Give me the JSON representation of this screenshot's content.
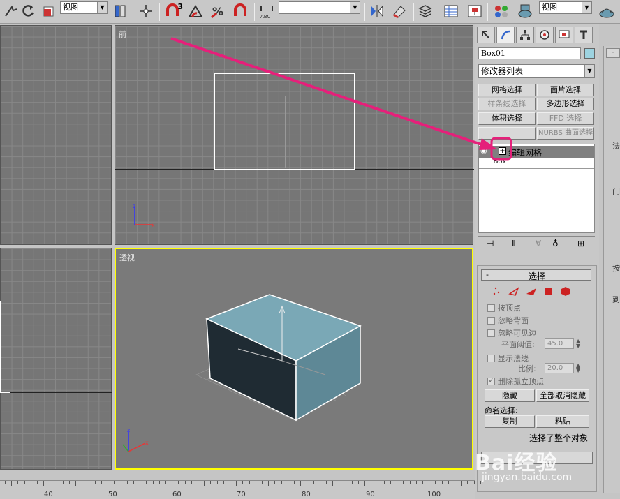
{
  "toolbar": {
    "view_dropdown": "视图",
    "snap_label": "3",
    "named_sel_dropdown": "",
    "render_dropdown": "视图"
  },
  "viewports": {
    "front": {
      "label": "前"
    },
    "perspective": {
      "label": "透视"
    }
  },
  "command_panel": {
    "object_name": "Box01",
    "modifier_list": "修改器列表",
    "buttons": [
      "网格选择",
      "面片选择",
      "样条线选择",
      "多边形选择",
      "体积选择",
      "FFD 选择",
      "",
      "NURBS 曲面选择"
    ],
    "stack": {
      "edit_mesh": "编辑网格",
      "box": "Box"
    },
    "selection_rollout": {
      "minus": "-",
      "title": "选择",
      "by_vertex": "按顶点",
      "ignore_backface": "忽略背面",
      "ignore_visible_edges": "忽略可见边",
      "planar_thresh_label": "平面阈值:",
      "planar_thresh_value": "45.0",
      "show_normals": "显示法线",
      "scale_label": "比例:",
      "scale_value": "20.0",
      "delete_isolated": "删除孤立顶点",
      "hide": "隐藏",
      "unhide_all": "全部取消隐藏",
      "named_sel": "命名选择:",
      "copy": "复制",
      "paste": "粘贴",
      "status": "选择了整个对象"
    }
  },
  "right_strip": [
    "法",
    "门",
    "按",
    "到"
  ],
  "ruler": {
    "labels": [
      "40",
      "50",
      "60",
      "70",
      "80",
      "90",
      "100"
    ]
  },
  "watermark": {
    "brand": "Bai经验",
    "url": "jingyan.baidu.com"
  },
  "colors": {
    "accent_arrow": "#e5207a",
    "active_border": "#ffff00",
    "box_top": "#7aa8b6"
  }
}
